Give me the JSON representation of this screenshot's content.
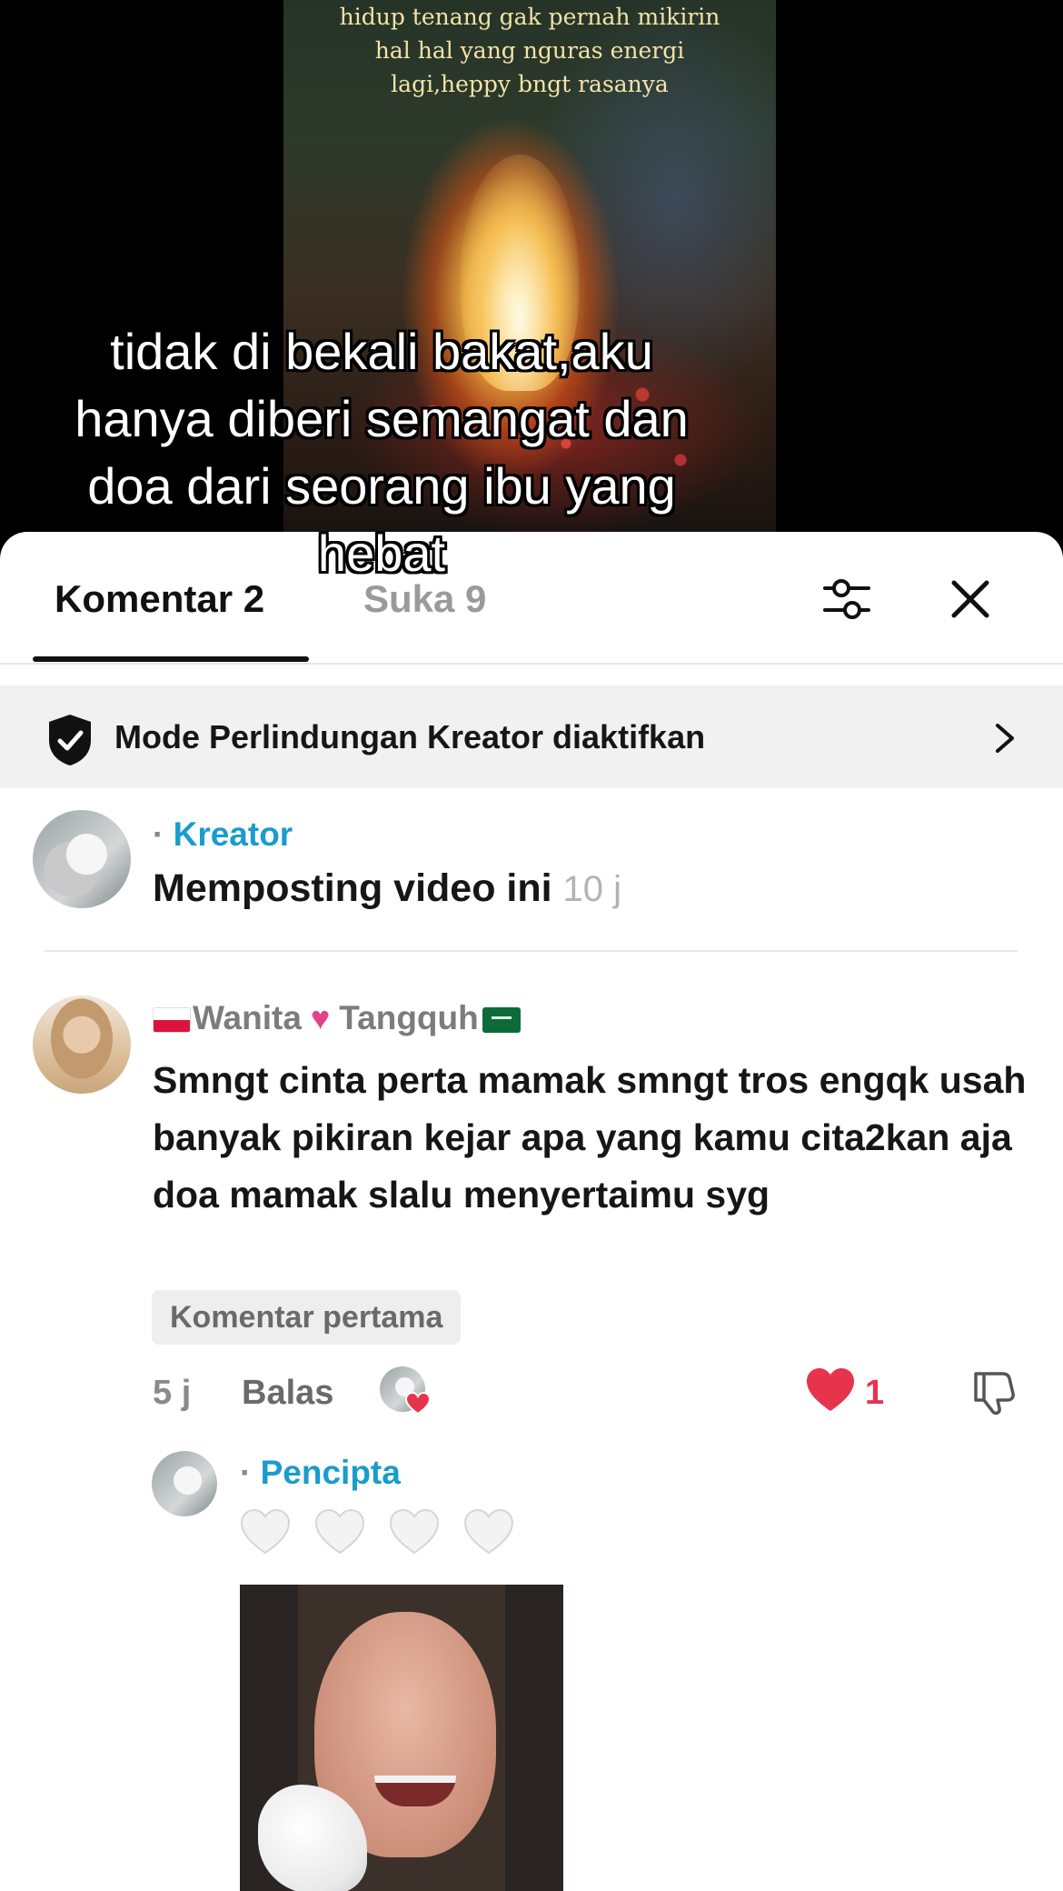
{
  "video": {
    "top_text": "hidup tenang gak pernah mikirin hal hal yang nguras energi lagi,heppy bngt rasanya",
    "caption": "tidak di bekali bakat,aku hanya diberi semangat dan doa dari seorang ibu yang hebat"
  },
  "tabs": {
    "comments": "Komentar 2",
    "likes": "Suka 9"
  },
  "icons": {
    "filter": "sliders-icon",
    "close": "close-icon",
    "shield": "shield-check-icon",
    "chevron": "chevron-right-icon",
    "apple": "apple-icon",
    "like": "heart-icon",
    "dislike": "thumbs-down-icon"
  },
  "protection_banner": {
    "label": "Mode Perlindungan Kreator diaktifkan"
  },
  "creator_post": {
    "apple": "",
    "separator": "·",
    "role": "Kreator",
    "text": "Memposting video ini",
    "time": "10 j"
  },
  "comment": {
    "author": "Wanita 💘 Tangquh",
    "author_parts": [
      "Wanita",
      "Tangquh"
    ],
    "text": "Smngt cinta perta mamak smngt tros engqk usah banyak pikiran kejar apa yang kamu cita2kan aja doa mamak slalu menyertaimu syg",
    "badge": "Komentar pertama",
    "time": "5 j",
    "reply_label": "Balas",
    "like_count": "1"
  },
  "reply": {
    "apple": "",
    "separator": "·",
    "role": "Pencipta",
    "hearts": "🤍🤍🤍🤍"
  },
  "colors": {
    "accent_blue": "#1a9ccc",
    "like_red": "#e7344d"
  }
}
